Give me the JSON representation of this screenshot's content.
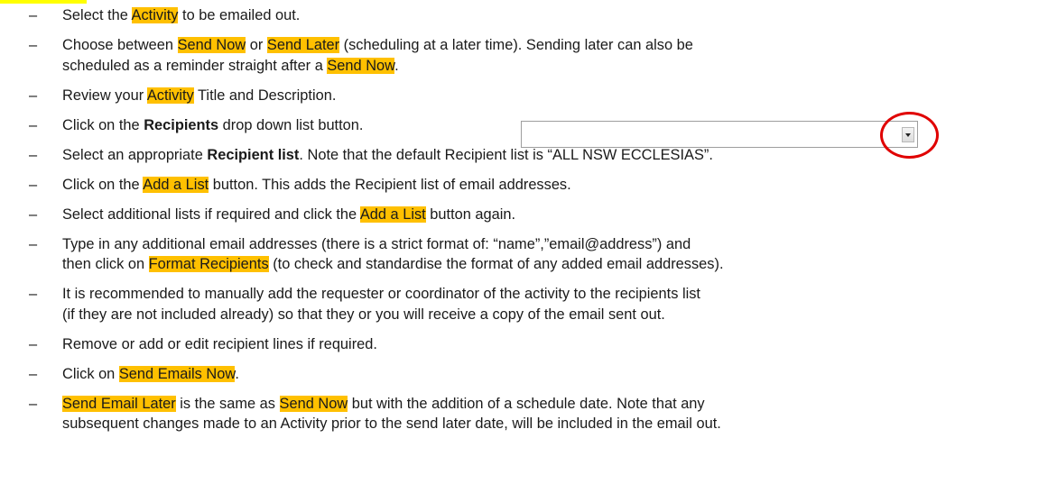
{
  "items": [
    {
      "p1": "Select the ",
      "h1": "Activity",
      "p2": " to be emailed out."
    },
    {
      "p1": "Choose between ",
      "h1": "Send Now",
      "p2": " or ",
      "h2": "Send Later",
      "p3": " (scheduling at a later time). Sending later can also be",
      "l2a": "scheduled as a reminder straight after a ",
      "l2h": "Send Now",
      "l2b": "."
    },
    {
      "p1": "Review your ",
      "h1": "Activity",
      "p2": " Title and Description."
    },
    {
      "p1": "Click on the ",
      "b1": "Recipients",
      "p2": " drop down list button."
    },
    {
      "p1": "Select an appropriate ",
      "b1": "Recipient list",
      "p2": ". Note that the default Recipient list is “ALL NSW ECCLESIAS”."
    },
    {
      "p1": "Click on the ",
      "h1": "Add a List",
      "p2": " button. This adds the Recipient list of email addresses."
    },
    {
      "p1": "Select additional lists if required and click the ",
      "h1": "Add a List",
      "p2": " button again."
    },
    {
      "p1": "Type in any additional email addresses (there is a strict format of: “name”,”email@address”) and",
      "l2a": "then click on ",
      "l2h": "Format Recipients",
      "l2b": " (to check and standardise the format of any added email addresses)."
    },
    {
      "p1": "It is recommended to manually add the requester or coordinator of the activity to the recipients list",
      "l2a": "(if they are not included already) so that they or you will receive a copy of the email sent out."
    },
    {
      "p1": "Remove or add or edit recipient lines if required."
    },
    {
      "p1": "Click on ",
      "h1": "Send Emails Now",
      "p2": "."
    },
    {
      "h1": "Send Email Later",
      "p2": " is the same as ",
      "h2": "Send Now",
      "p3": " but with the addition of a schedule date. Note that any",
      "l2a": "subsequent changes made to an Activity prior to the send later date, will be included in the email out."
    }
  ],
  "dash": "–"
}
